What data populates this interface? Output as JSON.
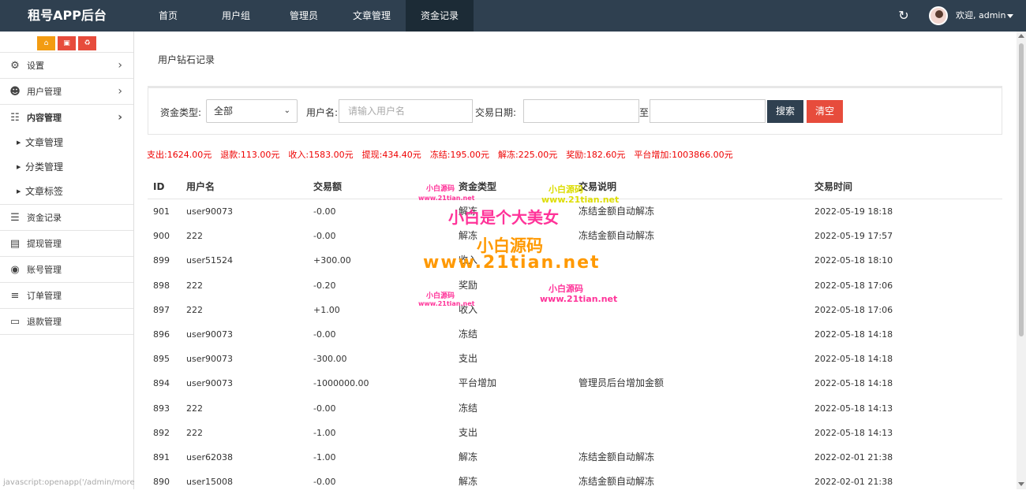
{
  "app": {
    "title": "租号APP后台"
  },
  "topnav": [
    {
      "label": "首页",
      "active": false
    },
    {
      "label": "用户组",
      "active": false
    },
    {
      "label": "管理员",
      "active": false
    },
    {
      "label": "文章管理",
      "active": false
    },
    {
      "label": "资金记录",
      "active": true
    }
  ],
  "header": {
    "refresh_icon": "refresh-icon",
    "user_greeting": "欢迎, admin"
  },
  "sidebar": {
    "tools": [
      "home-icon",
      "trash-icon",
      "recycle-icon"
    ],
    "items": [
      {
        "label": "设置",
        "icon": "gears-icon",
        "chevron": true
      },
      {
        "label": "用户管理",
        "icon": "users-icon",
        "chevron": true
      },
      {
        "label": "内容管理",
        "icon": "grid-icon",
        "chevron": true,
        "expanded": true,
        "children": [
          "文章管理",
          "分类管理",
          "文章标签"
        ]
      },
      {
        "label": "资金记录",
        "icon": "list-icon"
      },
      {
        "label": "提现管理",
        "icon": "money-icon"
      },
      {
        "label": "账号管理",
        "icon": "gamepad-icon"
      },
      {
        "label": "订单管理",
        "icon": "bars-icon"
      },
      {
        "label": "退款管理",
        "icon": "monitor-icon"
      }
    ],
    "status_url": "javascript:openapp('/admin/more"
  },
  "page": {
    "title": "用户钻石记录"
  },
  "filter": {
    "type_label": "资金类型:",
    "type_value": "全部",
    "username_label": "用户名:",
    "username_placeholder": "请输入用户名",
    "date_label": "交易日期:",
    "date_to": "至",
    "search_button": "搜索",
    "clear_button": "清空"
  },
  "summary": [
    "支出:1624.00元",
    "退款:113.00元",
    "收入:1583.00元",
    "提现:434.40元",
    "冻结:195.00元",
    "解冻:225.00元",
    "奖励:182.60元",
    "平台增加:1003866.00元"
  ],
  "table": {
    "columns": [
      "ID",
      "用户名",
      "交易额",
      "资金类型",
      "交易说明",
      "交易时间"
    ],
    "rows": [
      [
        "901",
        "user90073",
        "-0.00",
        "解冻",
        "冻结金额自动解冻",
        "2022-05-19 18:18"
      ],
      [
        "900",
        "222",
        "-0.00",
        "解冻",
        "冻结金额自动解冻",
        "2022-05-19 17:57"
      ],
      [
        "899",
        "user51524",
        "+300.00",
        "收入",
        "",
        "2022-05-18 18:10"
      ],
      [
        "898",
        "222",
        "-0.20",
        "奖励",
        "",
        "2022-05-18 17:06"
      ],
      [
        "897",
        "222",
        "+1.00",
        "收入",
        "",
        "2022-05-18 17:06"
      ],
      [
        "896",
        "user90073",
        "-0.00",
        "冻结",
        "",
        "2022-05-18 14:18"
      ],
      [
        "895",
        "user90073",
        "-300.00",
        "支出",
        "",
        "2022-05-18 14:18"
      ],
      [
        "894",
        "user90073",
        "-1000000.00",
        "平台增加",
        "管理员后台增加金额",
        "2022-05-18 14:18"
      ],
      [
        "893",
        "222",
        "-0.00",
        "冻结",
        "",
        "2022-05-18 14:13"
      ],
      [
        "892",
        "222",
        "-1.00",
        "支出",
        "",
        "2022-05-18 14:13"
      ],
      [
        "891",
        "user62038",
        "-1.00",
        "解冻",
        "冻结金额自动解冻",
        "2022-02-01 21:38"
      ],
      [
        "890",
        "user15008",
        "-0.00",
        "解冻",
        "冻结金额自动解冻",
        "2022-02-01 21:38"
      ]
    ]
  },
  "watermarks": [
    {
      "text": "小白是个大美女",
      "color": "#ff3399"
    },
    {
      "text": "小白源码",
      "color": "#ff9900"
    },
    {
      "text": "www.21tian.net",
      "color": "#ff9900"
    },
    {
      "text": "小白源码",
      "color": "#ff3399"
    },
    {
      "text": "www.21tian.net",
      "color": "#ff3399"
    },
    {
      "text": "小白源码",
      "color": "#dddd00"
    },
    {
      "text": "www.21tian.net",
      "color": "#dddd00"
    },
    {
      "text": "小白源码",
      "color": "#ff3399"
    },
    {
      "text": "www.21tian.net",
      "color": "#ff3399"
    },
    {
      "text": "小白源码",
      "color": "#ff3399"
    },
    {
      "text": "www.21tian.net",
      "color": "#ff3399"
    }
  ]
}
